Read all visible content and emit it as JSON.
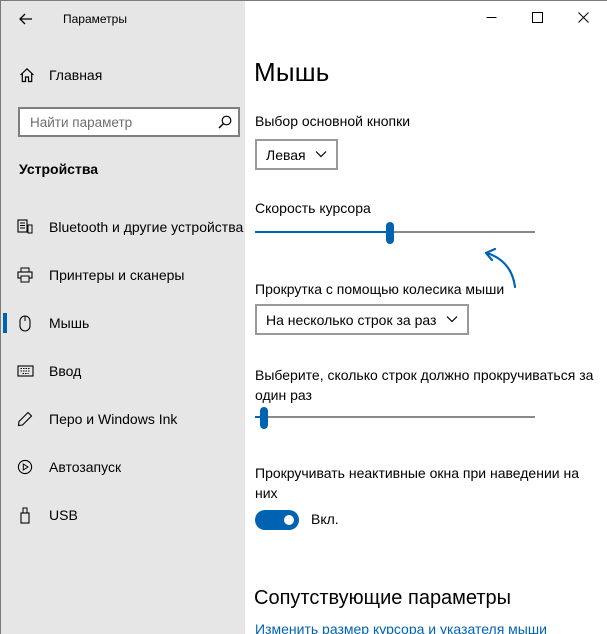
{
  "app": {
    "title": "Параметры"
  },
  "sidebar": {
    "home_label": "Главная",
    "search_placeholder": "Найти параметр",
    "section_title": "Устройства",
    "items": [
      {
        "label": "Bluetooth и другие устройства",
        "icon": "bluetooth-devices-icon"
      },
      {
        "label": "Принтеры и сканеры",
        "icon": "printer-icon"
      },
      {
        "label": "Мышь",
        "icon": "mouse-icon",
        "active": true
      },
      {
        "label": "Ввод",
        "icon": "keyboard-icon"
      },
      {
        "label": "Перо и Windows Ink",
        "icon": "pen-icon"
      },
      {
        "label": "Автозапуск",
        "icon": "autoplay-icon"
      },
      {
        "label": "USB",
        "icon": "usb-icon"
      }
    ]
  },
  "main": {
    "title": "Мышь",
    "primary_button": {
      "label": "Выбор основной кнопки",
      "value": "Левая"
    },
    "cursor_speed": {
      "label": "Скорость курсора",
      "level": 0.48
    },
    "scroll_mode": {
      "label": "Прокрутка с помощью колесика мыши",
      "value": "На несколько строк за раз"
    },
    "scroll_lines": {
      "label": "Выберите, сколько строк должно прокручиваться за один раз",
      "level": 0.02
    },
    "inactive_scroll": {
      "label": "Прокручивать неактивные окна при наведении на них",
      "state": "Вкл."
    },
    "related": {
      "title": "Сопутствующие параметры",
      "link": "Изменить размер курсора и указателя мыши"
    }
  },
  "colors": {
    "accent": "#0063b1",
    "sidebar_bg": "#e6e6e6"
  }
}
